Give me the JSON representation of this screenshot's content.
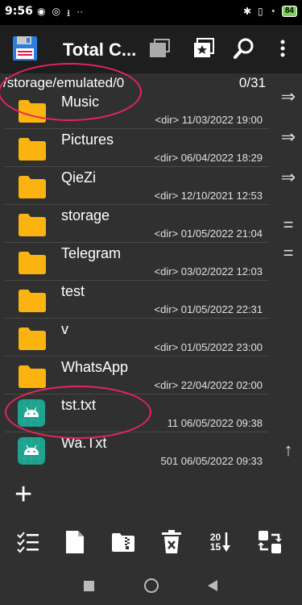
{
  "status_bar": {
    "time": "9:56",
    "battery": "84"
  },
  "app": {
    "title": "Total C..."
  },
  "path_bar": {
    "path": "/storage/emulated/0",
    "count": "0/31"
  },
  "files": [
    {
      "name": "Music",
      "meta": "<dir>  11/03/2022  19:00",
      "type": "folder"
    },
    {
      "name": "Pictures",
      "meta": "<dir>  06/04/2022  18:29",
      "type": "folder"
    },
    {
      "name": "QieZi",
      "meta": "<dir>  12/10/2021  12:53",
      "type": "folder"
    },
    {
      "name": "storage",
      "meta": "<dir>  01/05/2022  21:04",
      "type": "folder"
    },
    {
      "name": "Telegram",
      "meta": "<dir>  03/02/2022  12:03",
      "type": "folder"
    },
    {
      "name": "test",
      "meta": "<dir>  01/05/2022  22:31",
      "type": "folder"
    },
    {
      "name": "v",
      "meta": "<dir>  01/05/2022  23:00",
      "type": "folder"
    },
    {
      "name": "WhatsApp",
      "meta": "<dir>  22/04/2022  02:00",
      "type": "folder"
    },
    {
      "name": "tst.txt",
      "meta": "11  06/05/2022  09:38",
      "type": "android-file"
    },
    {
      "name": "Wa.Txt",
      "meta": "501  06/05/2022  09:33",
      "type": "android-file"
    }
  ],
  "side_buttons": [
    {
      "glyph": "⇒",
      "icon": "arrow-right-icon"
    },
    {
      "glyph": "⇒",
      "icon": "arrow-right-icon"
    },
    {
      "glyph": "⇒",
      "icon": "arrow-right-icon"
    },
    {
      "glyph": "=",
      "icon": "equals-icon"
    },
    {
      "glyph": "=",
      "icon": "equals-icon"
    },
    {
      "glyph": "↑",
      "icon": "arrow-up-icon"
    }
  ],
  "bottom_toolbar": {
    "sort_label_top": "20",
    "sort_label_bottom": "15"
  },
  "plus_label": "+",
  "colors": {
    "folder": "#fbb40f",
    "android_bg": "#1fa18e",
    "annotation": "#e8245c",
    "toolbar_accent": "#2c7fe0",
    "status_green": "#7bd35a"
  }
}
